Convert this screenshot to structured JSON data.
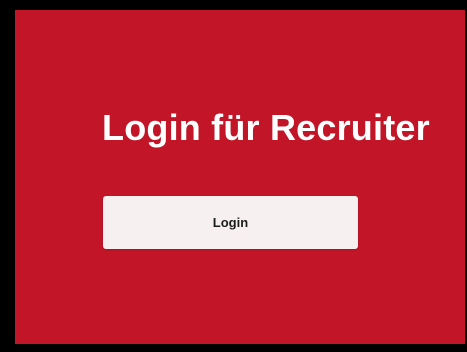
{
  "page": {
    "title": "Login für Recruiter"
  },
  "login_button": {
    "label": "Login"
  },
  "colors": {
    "panel_background": "#c21628",
    "outer_background": "#000000",
    "button_background": "#f7f0f1",
    "title_text": "#ffffff",
    "button_text": "#1c1c1c"
  }
}
